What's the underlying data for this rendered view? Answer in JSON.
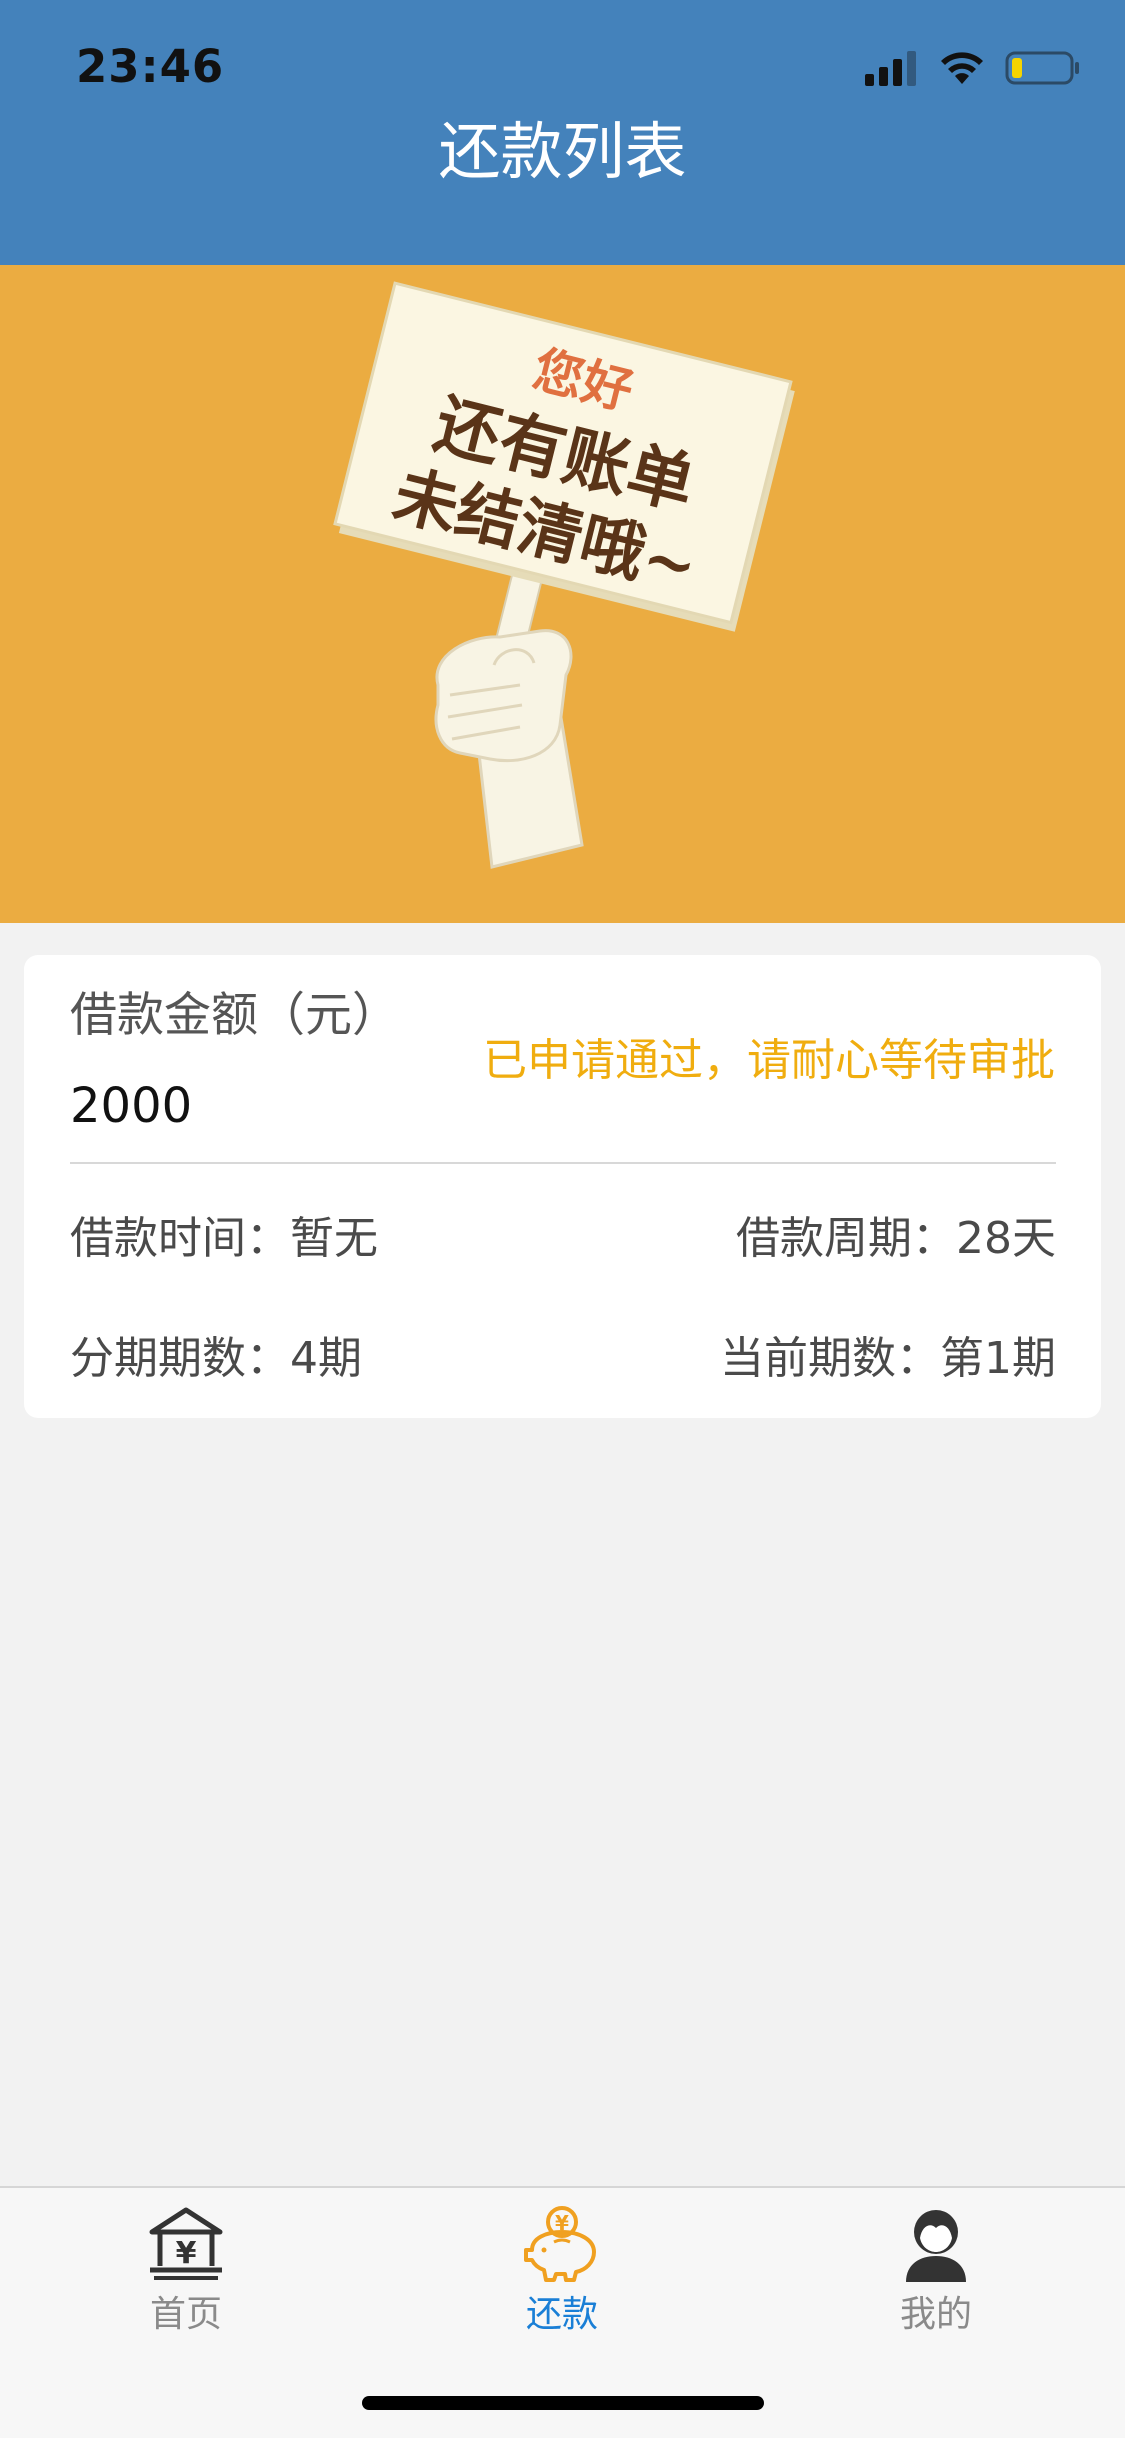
{
  "status_bar": {
    "time": "23:46",
    "icons": [
      "cellular-signal-icon",
      "wifi-icon",
      "battery-icon"
    ]
  },
  "header": {
    "title": "还款列表",
    "background_color": "#4482bb"
  },
  "banner": {
    "background_color": "#ebac41",
    "sign_line_1": "您好",
    "sign_line_2": "还有账单",
    "sign_line_3": "未结清哦~"
  },
  "loan_card": {
    "amount_label": "借款金额（元）",
    "amount_value": "2000",
    "status_text": "已申请通过，请耐心等待审批",
    "status_color": "#f0ad0f",
    "loan_time": "借款时间：暂无",
    "loan_period": "借款周期：28天",
    "installments": "分期期数：4期",
    "current_installment": "当前期数：第1期"
  },
  "tabbar": {
    "tabs": [
      {
        "label": "首页",
        "icon": "bank-yen-icon",
        "active": false
      },
      {
        "label": "还款",
        "icon": "piggy-bank-yen-icon",
        "active": true
      },
      {
        "label": "我的",
        "icon": "user-avatar-icon",
        "active": false
      }
    ],
    "active_color": "#1a7fd6",
    "active_icon_color": "#f0a020"
  }
}
